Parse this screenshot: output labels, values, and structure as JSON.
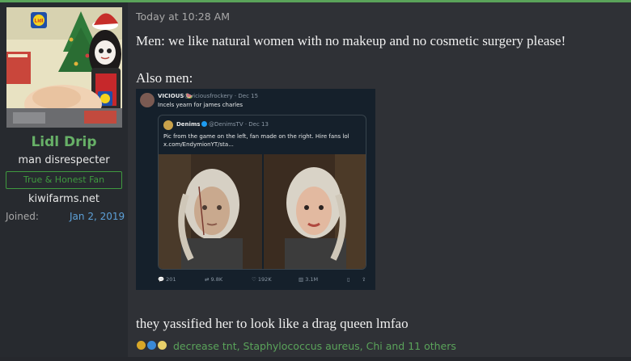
{
  "user": {
    "name": "Lidl Drip",
    "title": "man disrespecter",
    "banner": "True & Honest Fan",
    "website": "kiwifarms.net",
    "joined_label": "Joined:",
    "joined_date": "Jan 2, 2019",
    "avatar_logo_text": "Lidl"
  },
  "post": {
    "timestamp": "Today at 10:28 AM",
    "line1": "Men: we like natural women with no makeup and no cosmetic surgery please!",
    "line2": "Also men:",
    "line3": "they yassified her to look like a drag queen lmfao"
  },
  "embed": {
    "author": "VICIOUS 🍉",
    "handle": "@viciousfrockery · Dec 15",
    "text": "Incels yearn for james charles",
    "quote": {
      "author": "Denims",
      "handle": "@DenimsTV · Dec 13",
      "line1": "Pic from the game on the left, fan made on the right. Hire fans lol",
      "line2": "x.com/EndymionYT/sta..."
    },
    "actions": {
      "replies": "201",
      "retweets": "9.8K",
      "likes": "192K",
      "views": "3.1M"
    }
  },
  "reactions": {
    "text": "decrease tnt, Staphylococcus aureus, Chi and 11 others",
    "icons": [
      "pineapple-icon",
      "thumbs-up-icon",
      "crescent-moon-icon"
    ]
  },
  "colors": {
    "accent_green": "#5aa35a",
    "link_blue": "#5da0d8",
    "post_bg": "#2f3136",
    "user_col_bg": "#272a2f"
  }
}
